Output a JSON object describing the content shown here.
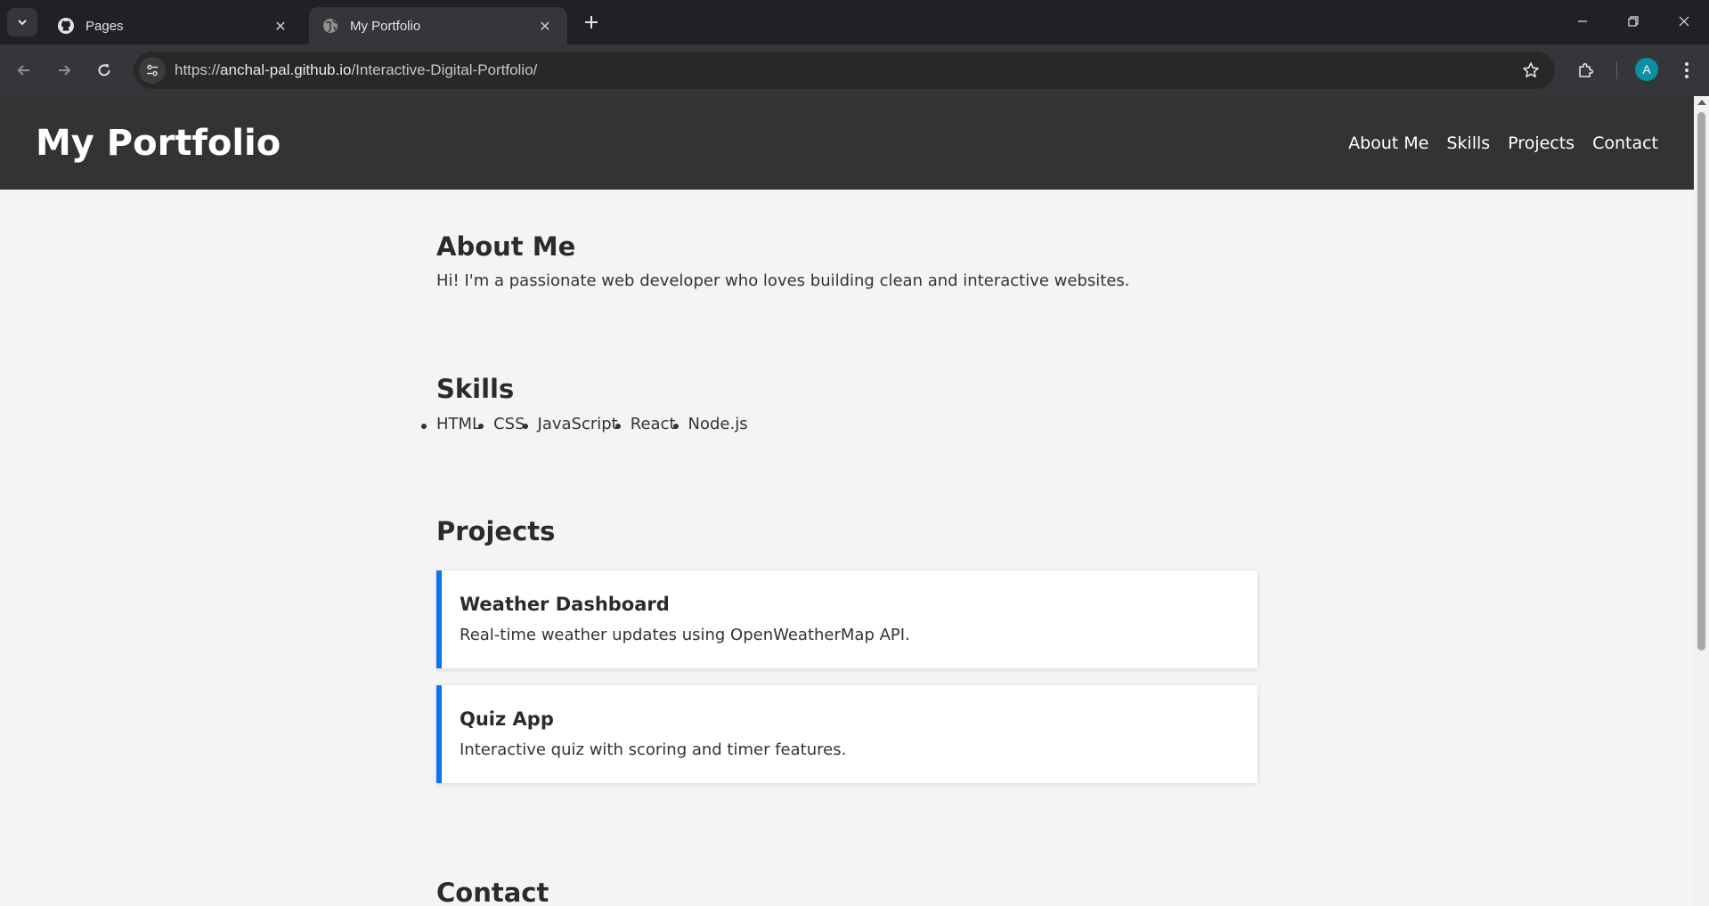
{
  "browser": {
    "tabs": [
      {
        "title": "Pages",
        "icon": "github-icon",
        "active": false
      },
      {
        "title": "My Portfolio",
        "icon": "globe-icon",
        "active": true
      }
    ],
    "url_prefix": "https://",
    "url_host": "anchal-pal.github.io",
    "url_path": "/Interactive-Digital-Portfolio/",
    "profile_initial": "A",
    "profile_color": "#0b8fa3"
  },
  "site": {
    "title": "My Portfolio",
    "nav": [
      "About Me",
      "Skills",
      "Projects",
      "Contact"
    ]
  },
  "about": {
    "heading": "About Me",
    "text": "Hi! I'm a passionate web developer who loves building clean and interactive websites."
  },
  "skills": {
    "heading": "Skills",
    "items": [
      "HTML",
      "CSS",
      "JavaScript",
      "React",
      "Node.js"
    ]
  },
  "projects": {
    "heading": "Projects",
    "items": [
      {
        "title": "Weather Dashboard",
        "desc": "Real-time weather updates using OpenWeatherMap API."
      },
      {
        "title": "Quiz App",
        "desc": "Interactive quiz with scoring and timer features."
      }
    ]
  },
  "contact": {
    "heading": "Contact"
  },
  "colors": {
    "accent": "#0a74ea",
    "header": "#333333",
    "page_bg": "#f4f4f4"
  }
}
